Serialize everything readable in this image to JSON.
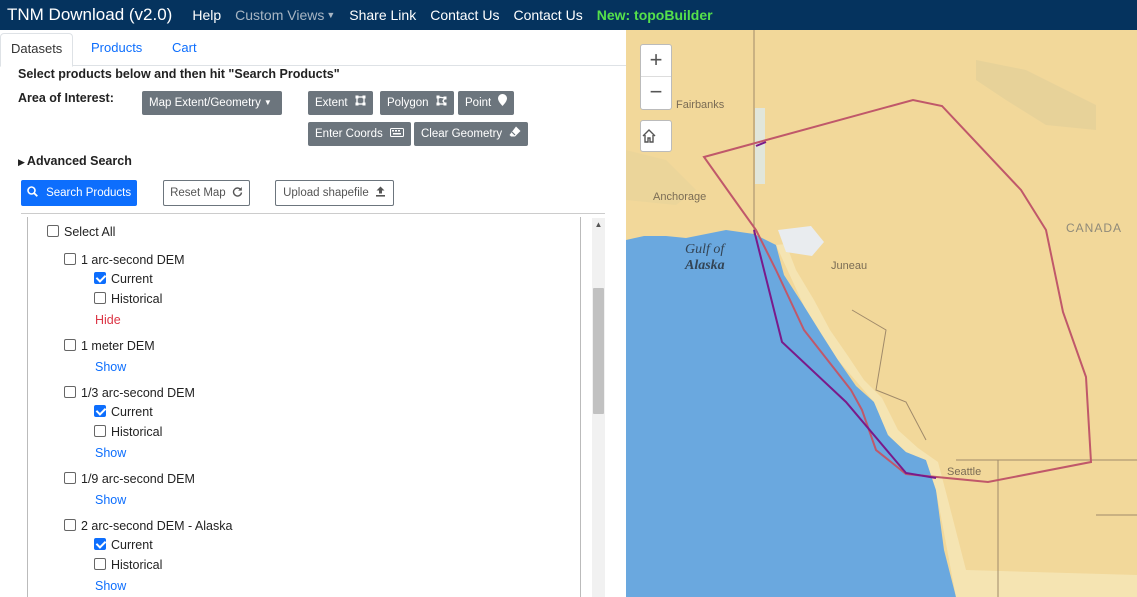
{
  "navbar": {
    "brand": "TNM Download (v2.0)",
    "links": {
      "help": "Help",
      "custom_views": "Custom Views",
      "share_link": "Share Link",
      "contact_us_1": "Contact Us",
      "contact_us_2": "Contact Us",
      "new_topobuilder": "New: topoBuilder"
    }
  },
  "tabs": [
    "Datasets",
    "Products",
    "Cart"
  ],
  "instructions": "Select products below and then hit \"Search Products\"",
  "area_of_interest": {
    "label": "Area of Interest:",
    "dropdown": "Map Extent/Geometry",
    "extent": "Extent",
    "polygon": "Polygon",
    "point": "Point",
    "enter_coords": "Enter Coords",
    "clear_geometry": "Clear Geometry"
  },
  "advanced_search": "Advanced Search",
  "actions": {
    "search_products": "Search Products",
    "reset_map": "Reset Map",
    "upload_shapefile": "Upload shapefile"
  },
  "dataset_list": {
    "select_all": "Select All",
    "items": [
      {
        "label": "1 arc-second DEM",
        "checked": false,
        "current": true,
        "historical": false,
        "toggle": "Hide"
      },
      {
        "label": "1 meter DEM",
        "checked": false,
        "toggle": "Show"
      },
      {
        "label": "1/3 arc-second DEM",
        "checked": false,
        "current": true,
        "historical": false,
        "toggle": "Show"
      },
      {
        "label": "1/9 arc-second DEM",
        "checked": false,
        "toggle": "Show"
      },
      {
        "label": "2 arc-second DEM - Alaska",
        "checked": false,
        "current": true,
        "historical": false,
        "toggle": "Show"
      }
    ],
    "current_label": "Current",
    "historical_label": "Historical"
  },
  "map": {
    "labels": {
      "fairbanks": "Fairbanks",
      "anchorage": "Anchorage",
      "gulf_of": "Gulf of",
      "alaska": "Alaska",
      "juneau": "Juneau",
      "canada": "CANADA",
      "seattle": "Seattle"
    },
    "colors": {
      "land": "#f2d89a",
      "ocean": "#6aa8df",
      "polygon": "#c0586a",
      "extent_line": "#7a1a8a"
    }
  }
}
